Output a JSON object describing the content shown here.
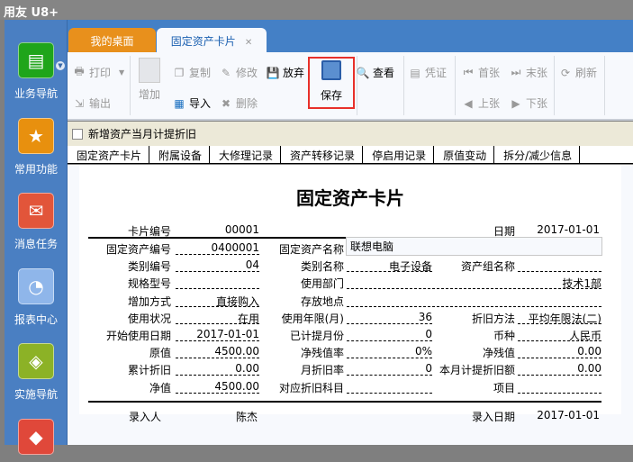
{
  "app": {
    "title": "用友 U8+"
  },
  "sidebar": {
    "items": [
      {
        "label": "业务导航",
        "icon": "folder-tree-icon",
        "color": "#1fa51a"
      },
      {
        "label": "常用功能",
        "icon": "star-folder-icon",
        "color": "#e8900e"
      },
      {
        "label": "消息任务",
        "icon": "mail-icon",
        "color": "#e2553a"
      },
      {
        "label": "报表中心",
        "icon": "report-chart-icon",
        "color": "#8fb6ea"
      },
      {
        "label": "实施导航",
        "icon": "compass-icon",
        "color": "#8cb226"
      },
      {
        "label": "",
        "icon": "modules-icon",
        "color": "#e0483a"
      }
    ]
  },
  "tabs": [
    {
      "label": "我的桌面"
    },
    {
      "label": "固定资产卡片",
      "close": "✕"
    }
  ],
  "toolbar": {
    "print": "打印",
    "export": "输出",
    "add": "增加",
    "copy": "复制",
    "import": "导入",
    "edit": "修改",
    "delete": "删除",
    "discard": "放弃",
    "save": "保存",
    "view": "查看",
    "voucher": "凭证",
    "first": "首张",
    "prev": "上张",
    "last": "末张",
    "next": "下张",
    "refresh": "刷新"
  },
  "checkbar": {
    "label": "新增资产当月计提折旧",
    "checked": false
  },
  "subtabs": [
    "固定资产卡片",
    "附属设备",
    "大修理记录",
    "资产转移记录",
    "停启用记录",
    "原值变动",
    "拆分/减少信息"
  ],
  "card": {
    "title": "固定资产卡片",
    "card_no_label": "卡片编号",
    "card_no": "00001",
    "date_label": "日期",
    "date": "2017-01-01",
    "asset_name_label": "固定资产名称",
    "asset_name": "联想电脑",
    "rows": [
      [
        {
          "l": "固定资产编号",
          "v": "0400001"
        },
        null,
        null
      ],
      [
        {
          "l": "类别编号",
          "v": "04"
        },
        {
          "l": "类别名称",
          "v": "电子设备"
        },
        {
          "l": "资产组名称",
          "v": ""
        }
      ],
      [
        {
          "l": "规格型号",
          "v": ""
        },
        {
          "l": "使用部门",
          "v": "技术1部",
          "span": true
        },
        null
      ],
      [
        {
          "l": "增加方式",
          "v": "直接购入"
        },
        {
          "l": "存放地点",
          "v": "",
          "span": true
        },
        null
      ],
      [
        {
          "l": "使用状况",
          "v": "在用"
        },
        {
          "l": "使用年限(月)",
          "v": "36"
        },
        {
          "l": "折旧方法",
          "v": "平均年限法(二)"
        }
      ],
      [
        {
          "l": "开始使用日期",
          "v": "2017-01-01"
        },
        {
          "l": "已计提月份",
          "v": "0"
        },
        {
          "l": "币种",
          "v": "人民币"
        }
      ],
      [
        {
          "l": "原值",
          "v": "4500.00"
        },
        {
          "l": "净残值率",
          "v": "0%"
        },
        {
          "l": "净残值",
          "v": "0.00"
        }
      ],
      [
        {
          "l": "累计折旧",
          "v": "0.00"
        },
        {
          "l": "月折旧率",
          "v": "0"
        },
        {
          "l": "本月计提折旧额",
          "v": "0.00"
        }
      ],
      [
        {
          "l": "净值",
          "v": "4500.00"
        },
        {
          "l": "对应折旧科目",
          "v": ""
        },
        {
          "l": "项目",
          "v": ""
        }
      ]
    ],
    "entered_by_label": "录入人",
    "entered_by": "陈杰",
    "entry_date_label": "录入日期",
    "entry_date": "2017-01-01"
  }
}
